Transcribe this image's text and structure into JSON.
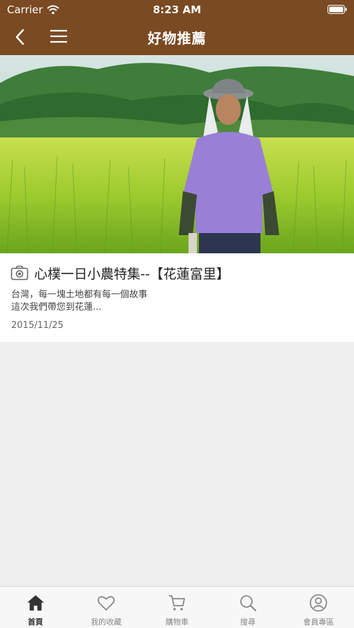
{
  "status_bar": {
    "carrier": "Carrier",
    "time": "8:23 AM"
  },
  "navbar": {
    "title": "好物推薦",
    "back_icon": "chevron-left-icon",
    "menu_icon": "hamburger-menu-icon"
  },
  "article": {
    "icon": "camera-icon",
    "title": "心樸一日小農特集--【花蓮富里】",
    "desc_line1": "台灣，每一塊土地都有每一個故事",
    "desc_line2": "這次我們帶您到花蓮...",
    "date": "2015/11/25"
  },
  "tabbar": {
    "items": [
      {
        "label": "首頁",
        "icon": "home-icon",
        "active": true
      },
      {
        "label": "我的收藏",
        "icon": "heart-icon",
        "active": false
      },
      {
        "label": "購物車",
        "icon": "cart-icon",
        "active": false
      },
      {
        "label": "搜尋",
        "icon": "search-icon",
        "active": false
      },
      {
        "label": "會員專區",
        "icon": "user-icon",
        "active": false
      }
    ]
  },
  "colors": {
    "header": "#7a4a22",
    "background": "#efefef",
    "tab_active": "#333333",
    "tab_inactive": "#888888"
  }
}
